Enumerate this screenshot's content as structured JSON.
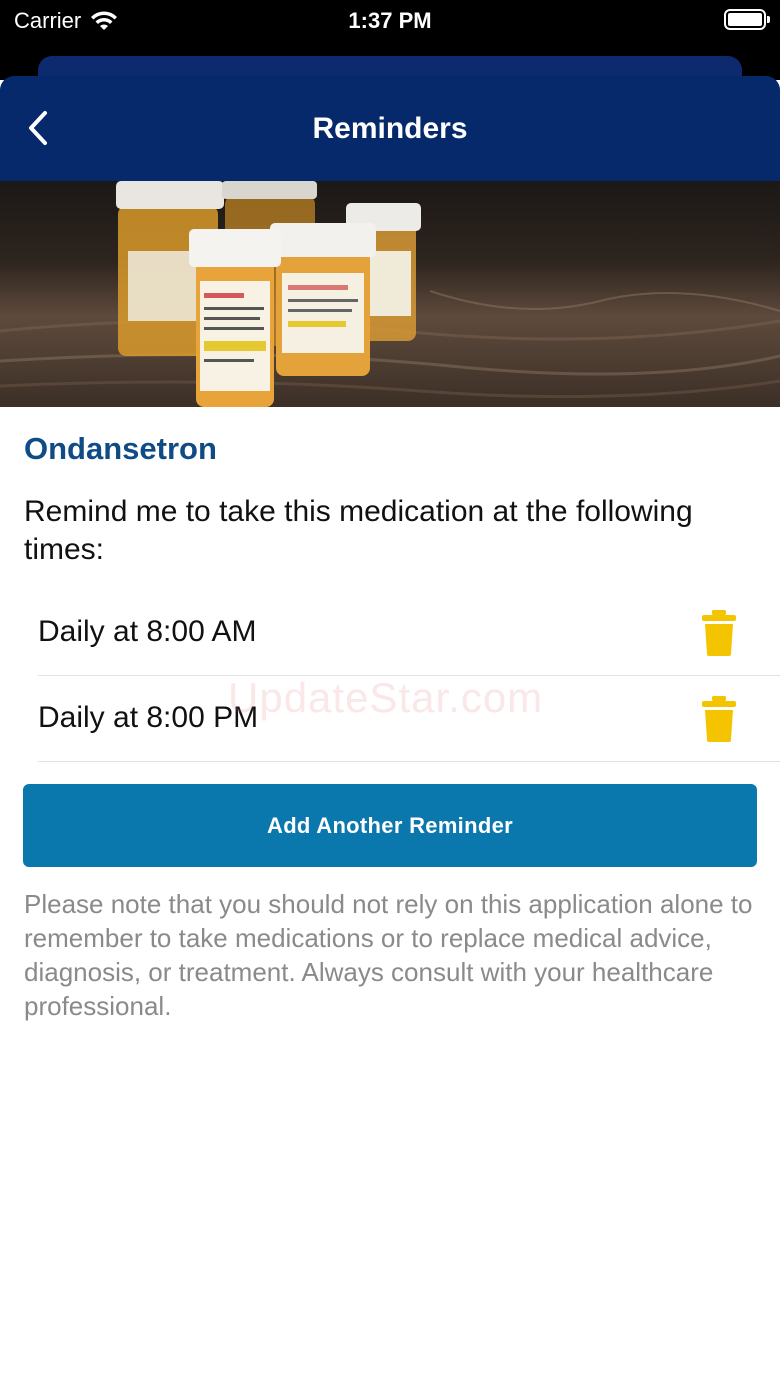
{
  "status_bar": {
    "carrier": "Carrier",
    "time": "1:37 PM"
  },
  "nav": {
    "title": "Reminders",
    "back_icon": "chevron-left-icon"
  },
  "medication": {
    "name": "Ondansetron",
    "intro": "Remind me to take this medication at the following times:"
  },
  "reminders": [
    {
      "label": "Daily at 8:00 AM",
      "delete_icon": "trash-icon"
    },
    {
      "label": "Daily at 8:00 PM",
      "delete_icon": "trash-icon"
    }
  ],
  "watermark": "UpdateStar.com",
  "add_button_label": "Add Another Reminder",
  "disclaimer": "Please note that you should not rely on this application alone to remember to take medications or to replace medical advice, diagnosis, or treatment. Always consult with your healthcare professional.",
  "colors": {
    "nav_background": "#06296b",
    "medication_name": "#0f4b86",
    "button": "#0a77ad",
    "trash": "#f5c400",
    "disclaimer_text": "#8a8a8a"
  }
}
